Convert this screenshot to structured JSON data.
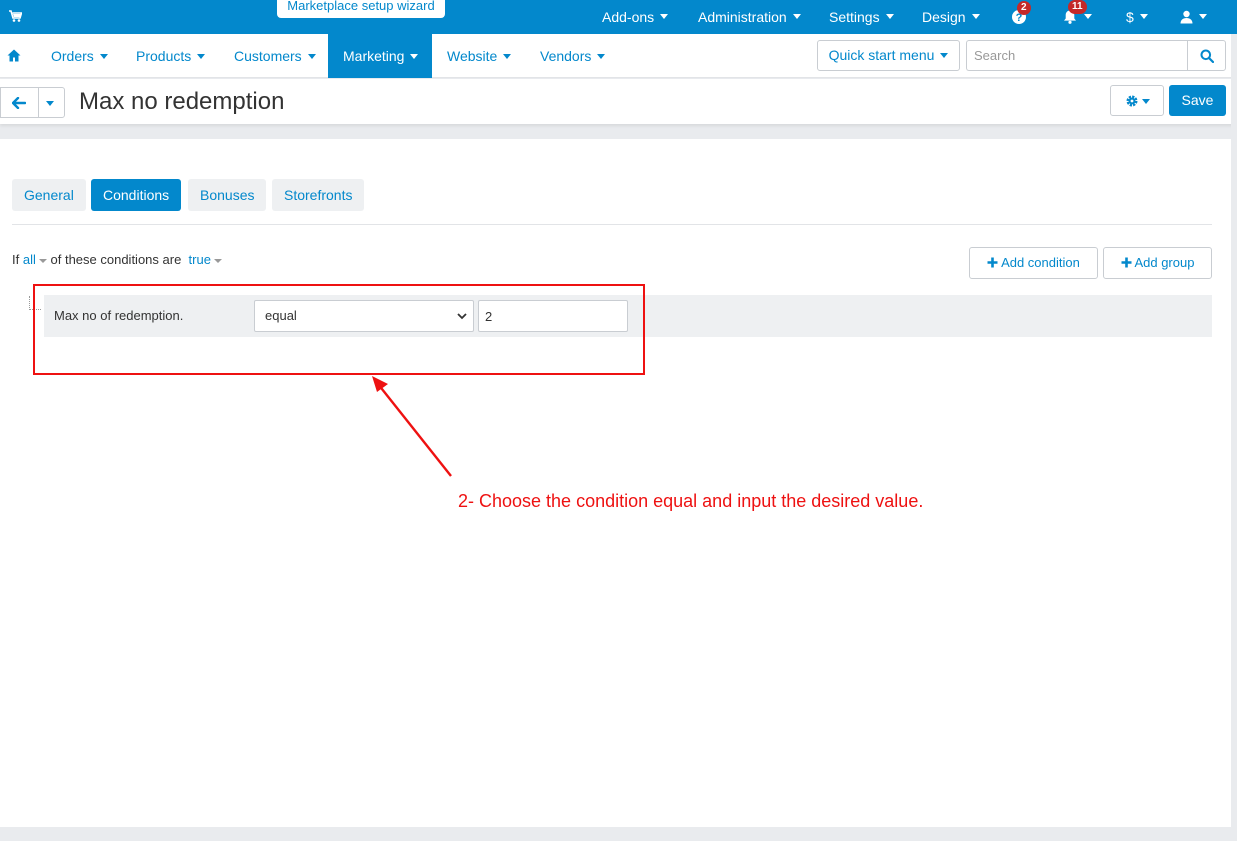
{
  "topbar": {
    "wizard_label": "Marketplace setup wizard",
    "addons": "Add-ons",
    "administration": "Administration",
    "settings": "Settings",
    "design": "Design",
    "help_badge": "2",
    "notifications_badge": "11",
    "currency": "$"
  },
  "nav": {
    "orders": "Orders",
    "products": "Products",
    "customers": "Customers",
    "marketing": "Marketing",
    "website": "Website",
    "vendors": "Vendors",
    "quick_start": "Quick start menu",
    "search_placeholder": "Search"
  },
  "page": {
    "title": "Max no redemption",
    "save_label": "Save"
  },
  "tabs": [
    "General",
    "Conditions",
    "Bonuses",
    "Storefronts"
  ],
  "conditions": {
    "prefix": "If",
    "all": "all",
    "middle": "of these conditions are",
    "truth": "true",
    "add_condition": "Add condition",
    "add_group": "Add group",
    "row": {
      "label": "Max no of redemption.",
      "operator": "equal",
      "value": "2"
    }
  },
  "annotation": {
    "text": "2- Choose the condition equal and input the desired value.",
    "color": "#ee1111"
  },
  "colors": {
    "brand": "#0388cc",
    "badge": "#c42929"
  }
}
